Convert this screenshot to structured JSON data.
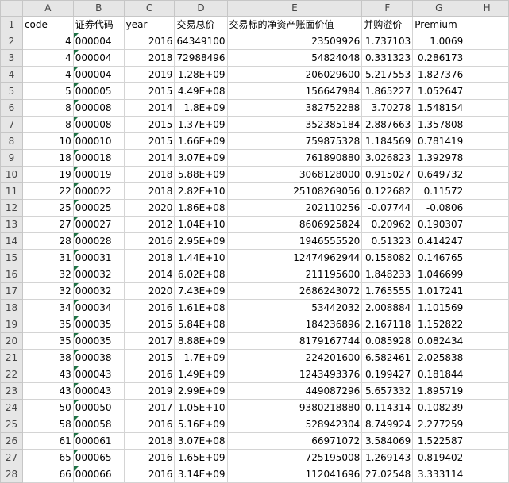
{
  "columns": [
    "A",
    "B",
    "C",
    "D",
    "E",
    "F",
    "G",
    "H"
  ],
  "headers": [
    "code",
    "证券代码",
    "year",
    "交易总价",
    "交易标的净资产账面价值",
    "并购溢价",
    "Premium",
    ""
  ],
  "rows": [
    {
      "n": "2",
      "a": "4",
      "b": "000004",
      "c": "2016",
      "d": "64349100",
      "e": "23509926",
      "f": "1.737103",
      "g": "1.0069"
    },
    {
      "n": "3",
      "a": "4",
      "b": "000004",
      "c": "2018",
      "d": "72988496",
      "e": "54824048",
      "f": "0.331323",
      "g": "0.286173"
    },
    {
      "n": "4",
      "a": "4",
      "b": "000004",
      "c": "2019",
      "d": "1.28E+09",
      "e": "206029600",
      "f": "5.217553",
      "g": "1.827376"
    },
    {
      "n": "5",
      "a": "5",
      "b": "000005",
      "c": "2015",
      "d": "4.49E+08",
      "e": "156647984",
      "f": "1.865227",
      "g": "1.052647"
    },
    {
      "n": "6",
      "a": "8",
      "b": "000008",
      "c": "2014",
      "d": "1.8E+09",
      "e": "382752288",
      "f": "3.70278",
      "g": "1.548154"
    },
    {
      "n": "7",
      "a": "8",
      "b": "000008",
      "c": "2015",
      "d": "1.37E+09",
      "e": "352385184",
      "f": "2.887663",
      "g": "1.357808"
    },
    {
      "n": "8",
      "a": "10",
      "b": "000010",
      "c": "2015",
      "d": "1.66E+09",
      "e": "759875328",
      "f": "1.184569",
      "g": "0.781419"
    },
    {
      "n": "9",
      "a": "18",
      "b": "000018",
      "c": "2014",
      "d": "3.07E+09",
      "e": "761890880",
      "f": "3.026823",
      "g": "1.392978"
    },
    {
      "n": "10",
      "a": "19",
      "b": "000019",
      "c": "2018",
      "d": "5.88E+09",
      "e": "3068128000",
      "f": "0.915027",
      "g": "0.649732"
    },
    {
      "n": "11",
      "a": "22",
      "b": "000022",
      "c": "2018",
      "d": "2.82E+10",
      "e": "25108269056",
      "f": "0.122682",
      "g": "0.11572"
    },
    {
      "n": "12",
      "a": "25",
      "b": "000025",
      "c": "2020",
      "d": "1.86E+08",
      "e": "202110256",
      "f": "-0.07744",
      "g": "-0.0806"
    },
    {
      "n": "13",
      "a": "27",
      "b": "000027",
      "c": "2012",
      "d": "1.04E+10",
      "e": "8606925824",
      "f": "0.20962",
      "g": "0.190307"
    },
    {
      "n": "14",
      "a": "28",
      "b": "000028",
      "c": "2016",
      "d": "2.95E+09",
      "e": "1946555520",
      "f": "0.51323",
      "g": "0.414247"
    },
    {
      "n": "15",
      "a": "31",
      "b": "000031",
      "c": "2018",
      "d": "1.44E+10",
      "e": "12474962944",
      "f": "0.158082",
      "g": "0.146765"
    },
    {
      "n": "16",
      "a": "32",
      "b": "000032",
      "c": "2014",
      "d": "6.02E+08",
      "e": "211195600",
      "f": "1.848233",
      "g": "1.046699"
    },
    {
      "n": "17",
      "a": "32",
      "b": "000032",
      "c": "2020",
      "d": "7.43E+09",
      "e": "2686243072",
      "f": "1.765555",
      "g": "1.017241"
    },
    {
      "n": "18",
      "a": "34",
      "b": "000034",
      "c": "2016",
      "d": "1.61E+08",
      "e": "53442032",
      "f": "2.008884",
      "g": "1.101569"
    },
    {
      "n": "19",
      "a": "35",
      "b": "000035",
      "c": "2015",
      "d": "5.84E+08",
      "e": "184236896",
      "f": "2.167118",
      "g": "1.152822"
    },
    {
      "n": "20",
      "a": "35",
      "b": "000035",
      "c": "2017",
      "d": "8.88E+09",
      "e": "8179167744",
      "f": "0.085928",
      "g": "0.082434"
    },
    {
      "n": "21",
      "a": "38",
      "b": "000038",
      "c": "2015",
      "d": "1.7E+09",
      "e": "224201600",
      "f": "6.582461",
      "g": "2.025838"
    },
    {
      "n": "22",
      "a": "43",
      "b": "000043",
      "c": "2016",
      "d": "1.49E+09",
      "e": "1243493376",
      "f": "0.199427",
      "g": "0.181844"
    },
    {
      "n": "23",
      "a": "43",
      "b": "000043",
      "c": "2019",
      "d": "2.99E+09",
      "e": "449087296",
      "f": "5.657332",
      "g": "1.895719"
    },
    {
      "n": "24",
      "a": "50",
      "b": "000050",
      "c": "2017",
      "d": "1.05E+10",
      "e": "9380218880",
      "f": "0.114314",
      "g": "0.108239"
    },
    {
      "n": "25",
      "a": "58",
      "b": "000058",
      "c": "2016",
      "d": "5.16E+09",
      "e": "528942304",
      "f": "8.749924",
      "g": "2.277259"
    },
    {
      "n": "26",
      "a": "61",
      "b": "000061",
      "c": "2018",
      "d": "3.07E+08",
      "e": "66971072",
      "f": "3.584069",
      "g": "1.522587"
    },
    {
      "n": "27",
      "a": "65",
      "b": "000065",
      "c": "2016",
      "d": "1.65E+09",
      "e": "725195008",
      "f": "1.269143",
      "g": "0.819402"
    },
    {
      "n": "28",
      "a": "66",
      "b": "000066",
      "c": "2016",
      "d": "3.14E+09",
      "e": "112041696",
      "f": "27.02548",
      "g": "3.333114"
    }
  ],
  "colors": {
    "header_bg": "#e6e6e6",
    "grid": "#d4d4d4",
    "text_marker": "#1e7145"
  },
  "icons": {
    "text_marker": "number-stored-as-text-indicator"
  }
}
